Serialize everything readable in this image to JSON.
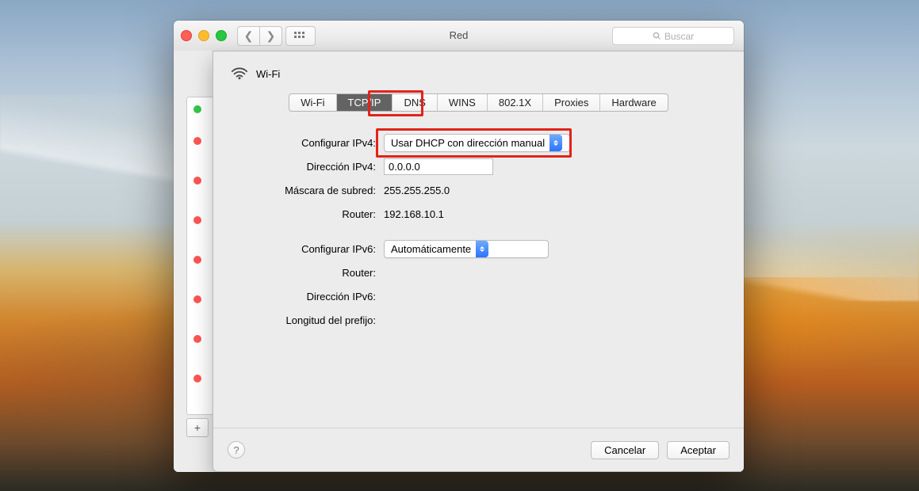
{
  "window": {
    "title": "Red",
    "search_placeholder": "Buscar"
  },
  "sheet": {
    "connection_name": "Wi-Fi",
    "tabs": [
      "Wi-Fi",
      "TCP/IP",
      "DNS",
      "WINS",
      "802.1X",
      "Proxies",
      "Hardware"
    ],
    "active_tab": "TCP/IP"
  },
  "labels": {
    "config_ipv4": "Configurar IPv4:",
    "ipv4_addr": "Dirección IPv4:",
    "subnet": "Máscara de subred:",
    "router4": "Router:",
    "config_ipv6": "Configurar IPv6:",
    "router6": "Router:",
    "ipv6_addr": "Dirección IPv6:",
    "prefix_len": "Longitud del prefijo:"
  },
  "values": {
    "config_ipv4": "Usar DHCP con dirección manual",
    "ipv4_addr": "0.0.0.0",
    "subnet": "255.255.255.0",
    "router4": "192.168.10.1",
    "config_ipv6": "Automáticamente",
    "router6": "",
    "ipv6_addr": "",
    "prefix_len": ""
  },
  "buttons": {
    "cancel": "Cancelar",
    "ok": "Aceptar",
    "add": "+"
  },
  "sidebar_status": [
    "green",
    "red",
    "red",
    "red",
    "red",
    "red",
    "red",
    "red"
  ]
}
